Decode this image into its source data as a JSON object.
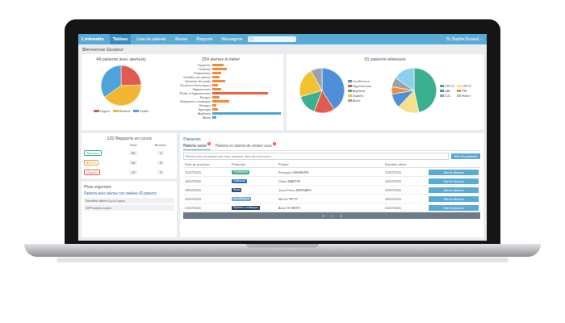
{
  "app": {
    "logo": "Linkwatts",
    "user": "Dr Sophie Durand",
    "search": {
      "placeholder": ""
    }
  },
  "nav": [
    {
      "label": "Tableau",
      "selected": true
    },
    {
      "label": "Liste de patients",
      "selected": false
    },
    {
      "label": "Alertes",
      "selected": false
    },
    {
      "label": "Rapports",
      "selected": false
    },
    {
      "label": "Messagerie",
      "selected": false
    }
  ],
  "welcome": "Bienvenue Docteur",
  "alerts_pie": {
    "title": "49 patients avec alerte(s)",
    "slices": [
      {
        "label": "Urgent",
        "value": 12,
        "color": "#e05a4f"
      },
      {
        "label": "Modéré",
        "value": 20,
        "color": "#f2b630"
      },
      {
        "label": "Faible",
        "value": 17,
        "color": "#4fa3d9"
      }
    ]
  },
  "alerts_bars": {
    "title": "154 alertes à traiter",
    "bars": [
      {
        "label": "Dyspnée",
        "value": 6,
        "color": "#f08a3c"
      },
      {
        "label": "Oedème",
        "value": 8,
        "color": "#f08a3c"
      },
      {
        "label": "Palpitations",
        "value": 5,
        "color": "#f08a3c"
      },
      {
        "label": "Troubles du rythme",
        "value": 4,
        "color": "#f08a3c"
      },
      {
        "label": "Variation de poids",
        "value": 7,
        "color": "#f08a3c"
      },
      {
        "label": "Douleurs thoraciques",
        "value": 3,
        "color": "#f08a3c"
      },
      {
        "label": "Hypotension",
        "value": 5,
        "color": "#f08a3c"
      },
      {
        "label": "Poids et hypertension",
        "value": 30,
        "color": "#e8643c"
      },
      {
        "label": "Fatigue",
        "value": 4,
        "color": "#f08a3c"
      },
      {
        "label": "Fréquence cardiaque",
        "value": 9,
        "color": "#f08a3c"
      },
      {
        "label": "Vertiges",
        "value": 2,
        "color": "#f08a3c"
      },
      {
        "label": "Syncope",
        "value": 3,
        "color": "#f08a3c"
      },
      {
        "label": "Arythmie",
        "value": 37,
        "color": "#4fa3d9"
      },
      {
        "label": "Autre",
        "value": 2,
        "color": "#4fa3d9"
      }
    ]
  },
  "monitored": {
    "title": "61 patients télésuivis",
    "pies": [
      {
        "slices": [
          {
            "label": "Insuffisance",
            "value": 25,
            "color": "#4f8fd9"
          },
          {
            "label": "Hypertension",
            "value": 9,
            "color": "#e05a4f"
          },
          {
            "label": "Arythmie",
            "value": 9,
            "color": "#3bb08f"
          },
          {
            "label": "Diabète",
            "value": 13,
            "color": "#f2c230"
          },
          {
            "label": "Autre",
            "value": 5,
            "color": "#9aa3ab"
          }
        ]
      },
      {
        "slices": [
          {
            "label": "CRT-D",
            "value": 27,
            "color": "#3bb08f"
          },
          {
            "label": "CRT-P",
            "value": 9,
            "color": "#f7e08a"
          },
          {
            "label": "DAI",
            "value": 6,
            "color": "#4f8fd9"
          },
          {
            "label": "PM",
            "value": 3,
            "color": "#f08a3c"
          },
          {
            "label": "ICD",
            "value": 4,
            "color": "#9aa3ab"
          },
          {
            "label": "Holter",
            "value": 9,
            "color": "#8ad0ee"
          }
        ]
      }
    ]
  },
  "reports": {
    "title": "132 Rapports en cours",
    "columns": [
      "Total",
      "À traiter"
    ],
    "rows": [
      {
        "label": "Normaux",
        "color": "#3bb08f",
        "total": "66",
        "todo": "4"
      },
      {
        "label": "Alertes",
        "color": "#f2a030",
        "total": "54",
        "todo": "8"
      },
      {
        "label": "Urgents",
        "color": "#e05a4f",
        "total": "12",
        "todo": "3"
      }
    ]
  },
  "urgent": {
    "title": "Plus urgentes",
    "subtitle": "Patients avec alertes non traitées 43 patients",
    "items": [
      "Dernière alerte il y a 4 jours",
      "18 Patients traités"
    ]
  },
  "patients": {
    "title": "Patients",
    "tabs": [
      {
        "label": "Patients suivis",
        "badge": "5",
        "selected": true
      },
      {
        "label": "Patients en attente de rendez-vous",
        "badge": "2",
        "selected": false
      }
    ],
    "search": {
      "placeholder": "Rechercher un patient par nom, prénom, date de naissance...",
      "button": "Voir les patients"
    },
    "columns": [
      "Date du prochain",
      "Protocole",
      "Patient",
      "Dernière alerte",
      ""
    ],
    "rows": [
      {
        "date": "15/07/2020",
        "tag": "Traitement",
        "color": "#3bb08f",
        "patient": "François LEFEBVRE",
        "alert": "12/07/2020",
        "action": "Voir le dossier"
      },
      {
        "date": "16/07/2020",
        "tag": "Télésuivi",
        "color": "#2f6fb3",
        "patient": "Claire MARTIN",
        "alert": "10/07/2020",
        "action": "Voir le dossier"
      },
      {
        "date": "18/07/2020",
        "tag": "Suivi",
        "color": "#2b4f7a",
        "patient": "Jean-Pierre BERNARD",
        "alert": "09/07/2020",
        "action": "Voir le dossier"
      },
      {
        "date": "20/07/2020",
        "tag": "Insuffisance",
        "color": "#6fa8d8",
        "patient": "Michel PETIT",
        "alert": "08/07/2020",
        "action": "Voir le dossier"
      },
      {
        "date": "22/07/2020",
        "tag": "Rythme cardiaque",
        "color": "#23456e",
        "patient": "Anne ROBERT",
        "alert": "05/07/2020",
        "action": "Voir le dossier"
      }
    ],
    "pages": [
      {
        "selected": false
      },
      {
        "selected": true
      },
      {
        "selected": false
      }
    ]
  }
}
